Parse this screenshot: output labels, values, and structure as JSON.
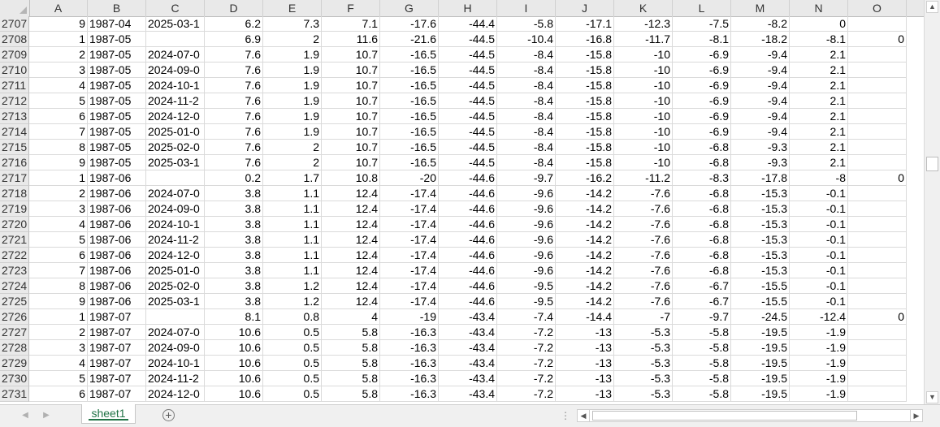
{
  "columns": [
    "A",
    "B",
    "C",
    "D",
    "E",
    "F",
    "G",
    "H",
    "I",
    "J",
    "K",
    "L",
    "M",
    "N",
    "O"
  ],
  "rows": [
    {
      "n": "2707",
      "c": [
        "9",
        "1987-04",
        "2025-03-1",
        "6.2",
        "7.3",
        "7.1",
        "-17.6",
        "-44.4",
        "-5.8",
        "-17.1",
        "-12.3",
        "-7.5",
        "-8.2",
        "0",
        ""
      ]
    },
    {
      "n": "2708",
      "c": [
        "1",
        "1987-05",
        "",
        "6.9",
        "2",
        "11.6",
        "-21.6",
        "-44.5",
        "-10.4",
        "-16.8",
        "-11.7",
        "-8.1",
        "-18.2",
        "-8.1",
        "0"
      ]
    },
    {
      "n": "2709",
      "c": [
        "2",
        "1987-05",
        "2024-07-0",
        "7.6",
        "1.9",
        "10.7",
        "-16.5",
        "-44.5",
        "-8.4",
        "-15.8",
        "-10",
        "-6.9",
        "-9.4",
        "2.1",
        ""
      ]
    },
    {
      "n": "2710",
      "c": [
        "3",
        "1987-05",
        "2024-09-0",
        "7.6",
        "1.9",
        "10.7",
        "-16.5",
        "-44.5",
        "-8.4",
        "-15.8",
        "-10",
        "-6.9",
        "-9.4",
        "2.1",
        ""
      ]
    },
    {
      "n": "2711",
      "c": [
        "4",
        "1987-05",
        "2024-10-1",
        "7.6",
        "1.9",
        "10.7",
        "-16.5",
        "-44.5",
        "-8.4",
        "-15.8",
        "-10",
        "-6.9",
        "-9.4",
        "2.1",
        ""
      ]
    },
    {
      "n": "2712",
      "c": [
        "5",
        "1987-05",
        "2024-11-2",
        "7.6",
        "1.9",
        "10.7",
        "-16.5",
        "-44.5",
        "-8.4",
        "-15.8",
        "-10",
        "-6.9",
        "-9.4",
        "2.1",
        ""
      ]
    },
    {
      "n": "2713",
      "c": [
        "6",
        "1987-05",
        "2024-12-0",
        "7.6",
        "1.9",
        "10.7",
        "-16.5",
        "-44.5",
        "-8.4",
        "-15.8",
        "-10",
        "-6.9",
        "-9.4",
        "2.1",
        ""
      ]
    },
    {
      "n": "2714",
      "c": [
        "7",
        "1987-05",
        "2025-01-0",
        "7.6",
        "1.9",
        "10.7",
        "-16.5",
        "-44.5",
        "-8.4",
        "-15.8",
        "-10",
        "-6.9",
        "-9.4",
        "2.1",
        ""
      ]
    },
    {
      "n": "2715",
      "c": [
        "8",
        "1987-05",
        "2025-02-0",
        "7.6",
        "2",
        "10.7",
        "-16.5",
        "-44.5",
        "-8.4",
        "-15.8",
        "-10",
        "-6.8",
        "-9.3",
        "2.1",
        ""
      ]
    },
    {
      "n": "2716",
      "c": [
        "9",
        "1987-05",
        "2025-03-1",
        "7.6",
        "2",
        "10.7",
        "-16.5",
        "-44.5",
        "-8.4",
        "-15.8",
        "-10",
        "-6.8",
        "-9.3",
        "2.1",
        ""
      ]
    },
    {
      "n": "2717",
      "c": [
        "1",
        "1987-06",
        "",
        "0.2",
        "1.7",
        "10.8",
        "-20",
        "-44.6",
        "-9.7",
        "-16.2",
        "-11.2",
        "-8.3",
        "-17.8",
        "-8",
        "0"
      ]
    },
    {
      "n": "2718",
      "c": [
        "2",
        "1987-06",
        "2024-07-0",
        "3.8",
        "1.1",
        "12.4",
        "-17.4",
        "-44.6",
        "-9.6",
        "-14.2",
        "-7.6",
        "-6.8",
        "-15.3",
        "-0.1",
        ""
      ]
    },
    {
      "n": "2719",
      "c": [
        "3",
        "1987-06",
        "2024-09-0",
        "3.8",
        "1.1",
        "12.4",
        "-17.4",
        "-44.6",
        "-9.6",
        "-14.2",
        "-7.6",
        "-6.8",
        "-15.3",
        "-0.1",
        ""
      ]
    },
    {
      "n": "2720",
      "c": [
        "4",
        "1987-06",
        "2024-10-1",
        "3.8",
        "1.1",
        "12.4",
        "-17.4",
        "-44.6",
        "-9.6",
        "-14.2",
        "-7.6",
        "-6.8",
        "-15.3",
        "-0.1",
        ""
      ]
    },
    {
      "n": "2721",
      "c": [
        "5",
        "1987-06",
        "2024-11-2",
        "3.8",
        "1.1",
        "12.4",
        "-17.4",
        "-44.6",
        "-9.6",
        "-14.2",
        "-7.6",
        "-6.8",
        "-15.3",
        "-0.1",
        ""
      ]
    },
    {
      "n": "2722",
      "c": [
        "6",
        "1987-06",
        "2024-12-0",
        "3.8",
        "1.1",
        "12.4",
        "-17.4",
        "-44.6",
        "-9.6",
        "-14.2",
        "-7.6",
        "-6.8",
        "-15.3",
        "-0.1",
        ""
      ]
    },
    {
      "n": "2723",
      "c": [
        "7",
        "1987-06",
        "2025-01-0",
        "3.8",
        "1.1",
        "12.4",
        "-17.4",
        "-44.6",
        "-9.6",
        "-14.2",
        "-7.6",
        "-6.8",
        "-15.3",
        "-0.1",
        ""
      ]
    },
    {
      "n": "2724",
      "c": [
        "8",
        "1987-06",
        "2025-02-0",
        "3.8",
        "1.2",
        "12.4",
        "-17.4",
        "-44.6",
        "-9.5",
        "-14.2",
        "-7.6",
        "-6.7",
        "-15.5",
        "-0.1",
        ""
      ]
    },
    {
      "n": "2725",
      "c": [
        "9",
        "1987-06",
        "2025-03-1",
        "3.8",
        "1.2",
        "12.4",
        "-17.4",
        "-44.6",
        "-9.5",
        "-14.2",
        "-7.6",
        "-6.7",
        "-15.5",
        "-0.1",
        ""
      ]
    },
    {
      "n": "2726",
      "c": [
        "1",
        "1987-07",
        "",
        "8.1",
        "0.8",
        "4",
        "-19",
        "-43.4",
        "-7.4",
        "-14.4",
        "-7",
        "-9.7",
        "-24.5",
        "-12.4",
        "0"
      ]
    },
    {
      "n": "2727",
      "c": [
        "2",
        "1987-07",
        "2024-07-0",
        "10.6",
        "0.5",
        "5.8",
        "-16.3",
        "-43.4",
        "-7.2",
        "-13",
        "-5.3",
        "-5.8",
        "-19.5",
        "-1.9",
        ""
      ]
    },
    {
      "n": "2728",
      "c": [
        "3",
        "1987-07",
        "2024-09-0",
        "10.6",
        "0.5",
        "5.8",
        "-16.3",
        "-43.4",
        "-7.2",
        "-13",
        "-5.3",
        "-5.8",
        "-19.5",
        "-1.9",
        ""
      ]
    },
    {
      "n": "2729",
      "c": [
        "4",
        "1987-07",
        "2024-10-1",
        "10.6",
        "0.5",
        "5.8",
        "-16.3",
        "-43.4",
        "-7.2",
        "-13",
        "-5.3",
        "-5.8",
        "-19.5",
        "-1.9",
        ""
      ]
    },
    {
      "n": "2730",
      "c": [
        "5",
        "1987-07",
        "2024-11-2",
        "10.6",
        "0.5",
        "5.8",
        "-16.3",
        "-43.4",
        "-7.2",
        "-13",
        "-5.3",
        "-5.8",
        "-19.5",
        "-1.9",
        ""
      ]
    },
    {
      "n": "2731",
      "c": [
        "6",
        "1987-07",
        "2024-12-0",
        "10.6",
        "0.5",
        "5.8",
        "-16.3",
        "-43.4",
        "-7.2",
        "-13",
        "-5.3",
        "-5.8",
        "-19.5",
        "-1.9",
        ""
      ]
    }
  ],
  "sheet_tab": "sheet1",
  "add_sheet_symbol": "+",
  "icons": {
    "scroll_up": "triangle-up-icon",
    "scroll_down": "triangle-down-icon",
    "scroll_left": "triangle-left-icon",
    "scroll_right": "triangle-right-icon",
    "add_sheet": "plus-circle-icon"
  }
}
